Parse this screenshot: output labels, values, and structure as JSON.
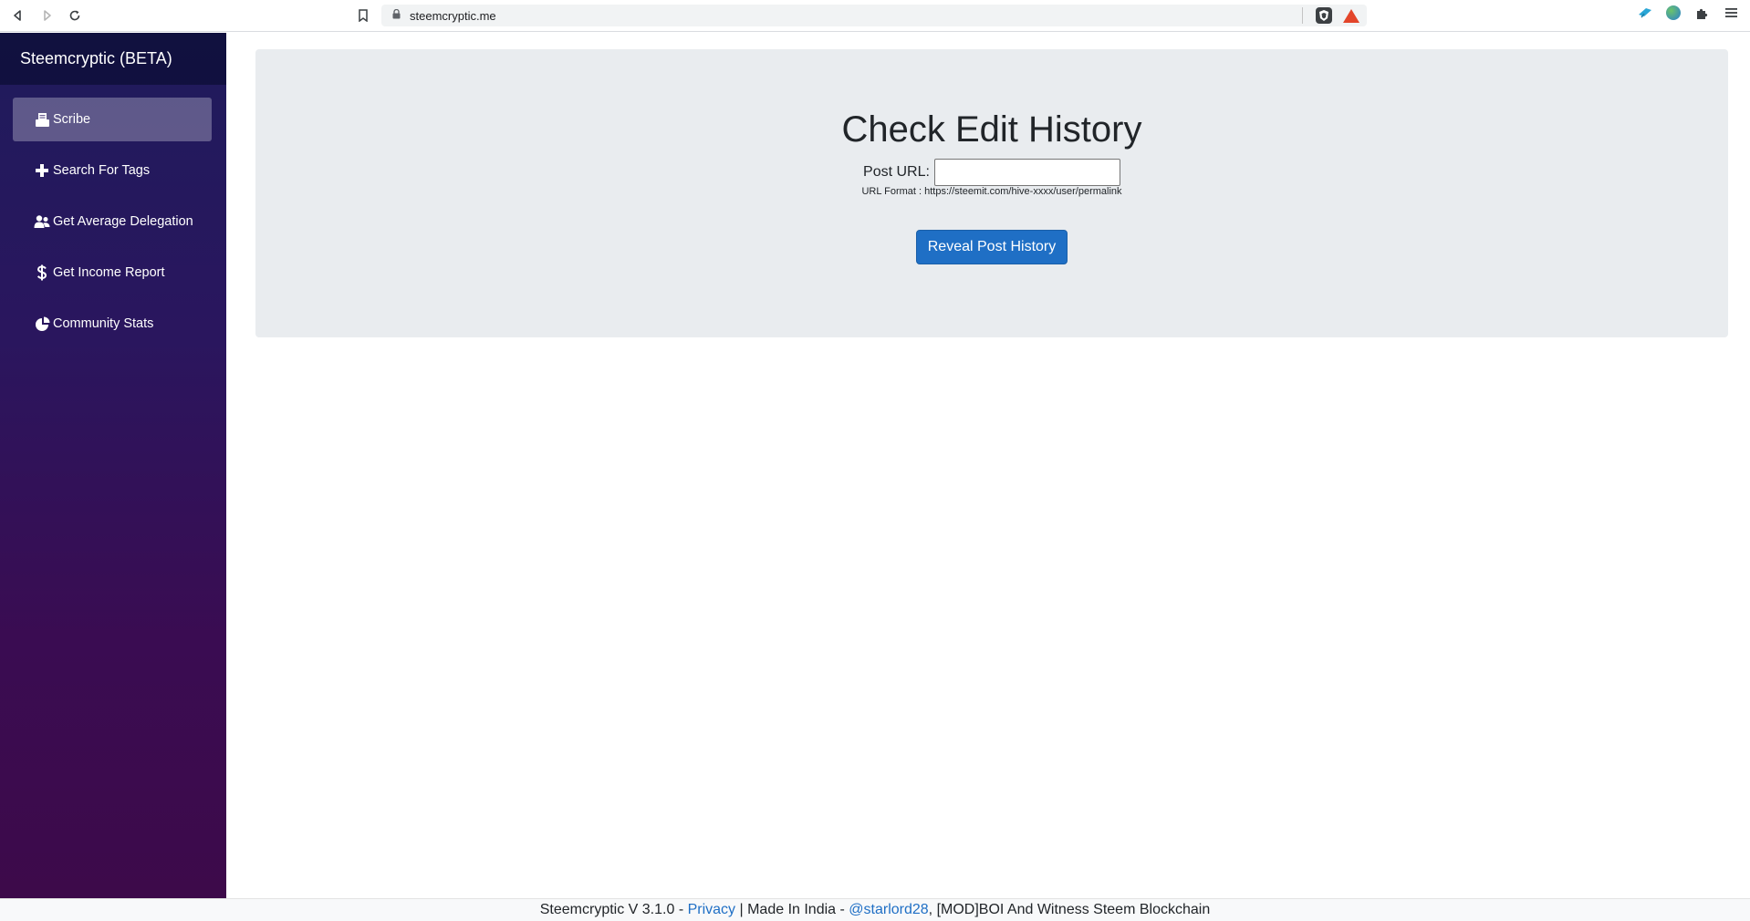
{
  "browser": {
    "url": "steemcryptic.me"
  },
  "sidebar": {
    "brand": "Steemcryptic (BETA)",
    "items": [
      {
        "label": "Scribe",
        "icon": "scribe-icon",
        "active": true
      },
      {
        "label": "Search For Tags",
        "icon": "plus-icon",
        "active": false
      },
      {
        "label": "Get Average Delegation",
        "icon": "users-icon",
        "active": false
      },
      {
        "label": "Get Income Report",
        "icon": "dollar-icon",
        "active": false
      },
      {
        "label": "Community Stats",
        "icon": "pie-chart-icon",
        "active": false
      }
    ]
  },
  "main": {
    "title": "Check Edit History",
    "input_label": "Post URL:",
    "input_value": "",
    "hint": "URL Format : https://steemit.com/hive-xxxx/user/permalink",
    "button_label": "Reveal Post History"
  },
  "footer": {
    "prefix": "Steemcryptic V 3.1.0 -",
    "privacy_link": "Privacy",
    "middle": "| Made In India -",
    "author_link": "@starlord28",
    "suffix": ", [MOD]BOI And Witness Steem Blockchain"
  },
  "colors": {
    "accent": "#1f6fc5",
    "sidebar_top": "#1f1b5c",
    "sidebar_bottom": "#3d0a4a",
    "jumbotron": "#e9ecef"
  }
}
